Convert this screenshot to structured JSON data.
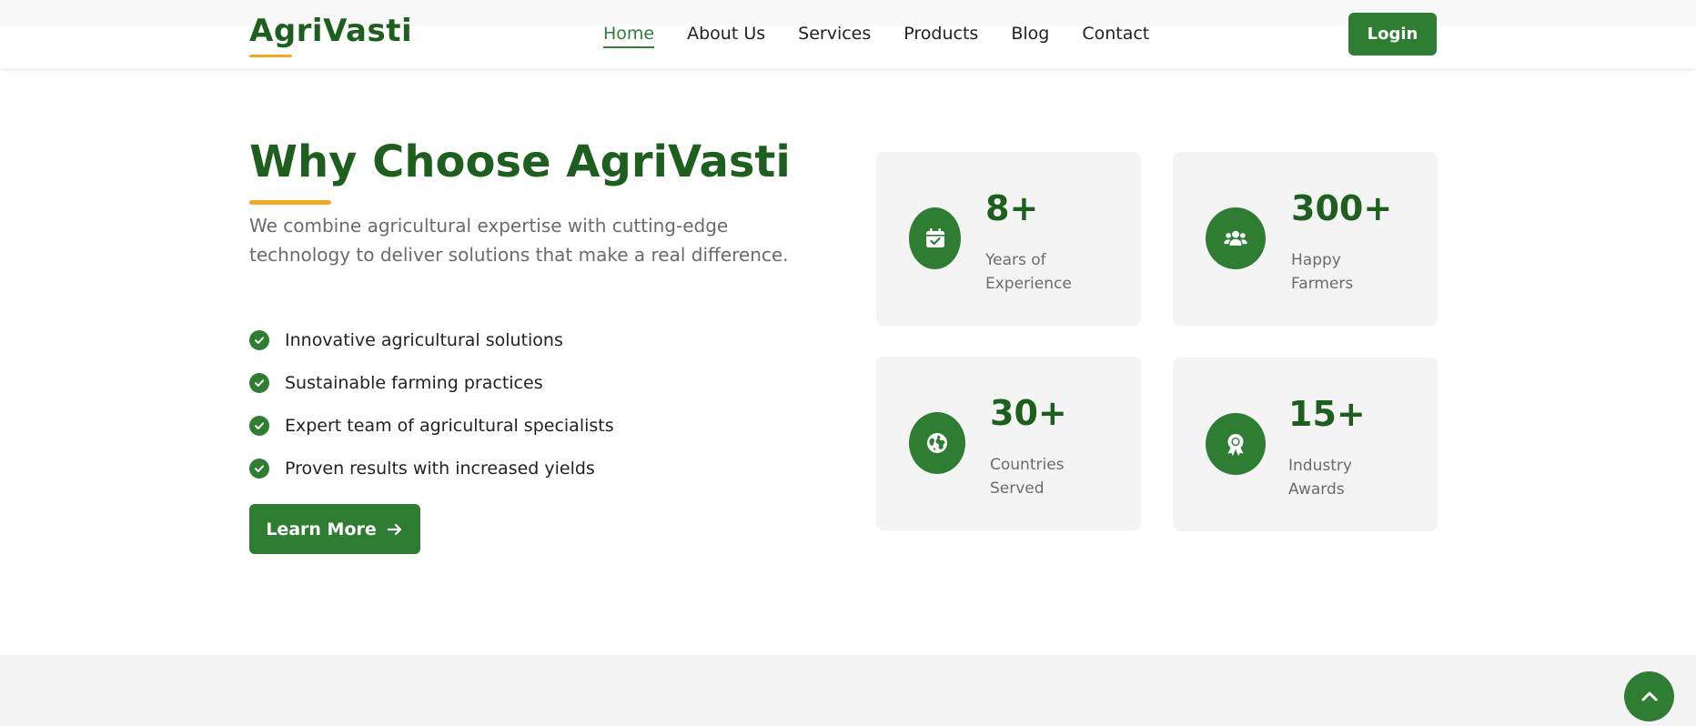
{
  "header": {
    "logo": "AgriVasti",
    "nav": [
      {
        "label": "Home",
        "active": true
      },
      {
        "label": "About Us",
        "active": false
      },
      {
        "label": "Services",
        "active": false
      },
      {
        "label": "Products",
        "active": false
      },
      {
        "label": "Blog",
        "active": false
      },
      {
        "label": "Contact",
        "active": false
      }
    ],
    "login_label": "Login"
  },
  "section": {
    "title": "Why Choose AgriVasti",
    "description": "We combine agricultural expertise with cutting-edge technology to deliver solutions that make a real difference.",
    "features": [
      "Innovative agricultural solutions",
      "Sustainable farming practices",
      "Expert team of agricultural specialists",
      "Proven results with increased yields"
    ],
    "learn_more_label": "Learn More"
  },
  "stats": [
    {
      "value": "8+",
      "label": "Years of Experience",
      "icon": "calendar-check-icon"
    },
    {
      "value": "300+",
      "label": "Happy Farmers",
      "icon": "users-icon"
    },
    {
      "value": "30+",
      "label": "Countries Served",
      "icon": "globe-icon"
    },
    {
      "value": "15+",
      "label": "Industry Awards",
      "icon": "award-icon"
    }
  ],
  "colors": {
    "primary": "#2e7d32",
    "dark_green": "#1e5f20",
    "accent": "#f5a623",
    "card_bg": "#f4f4f4",
    "text_muted": "#6b6b6b"
  }
}
